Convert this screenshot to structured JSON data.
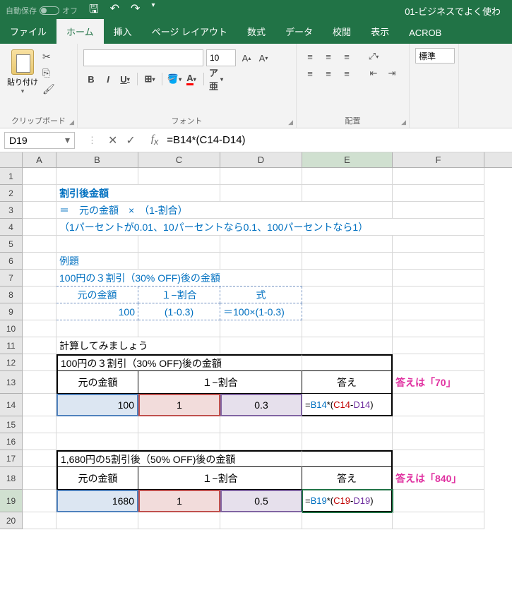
{
  "title_bar": {
    "autosave_label": "自動保存",
    "autosave_state": "オフ",
    "doc_title": "01-ビジネスでよく使わ"
  },
  "tabs": {
    "file": "ファイル",
    "home": "ホーム",
    "insert": "挿入",
    "page_layout": "ページ レイアウト",
    "formulas": "数式",
    "data": "データ",
    "review": "校閲",
    "view": "表示",
    "acrobat": "ACROB"
  },
  "ribbon": {
    "clipboard": {
      "paste": "貼り付け",
      "label": "クリップボード"
    },
    "font": {
      "size": "10",
      "label": "フォント"
    },
    "alignment": {
      "label": "配置"
    },
    "number": {
      "format": "標準"
    }
  },
  "formula_bar": {
    "namebox": "D19",
    "formula": "=B14*(C14-D14)"
  },
  "columns": [
    "A",
    "B",
    "C",
    "D",
    "E",
    "F"
  ],
  "cells": {
    "r2": {
      "b": "割引後金額"
    },
    "r3": {
      "b": "＝　元の金額　×　（1-割合）"
    },
    "r4": {
      "b": "（1パーセントが0.01、10パーセントなら0.1、100パーセントなら1）"
    },
    "r6": {
      "b": "例題"
    },
    "r7": {
      "b": "100円の３割引（30% OFF)後の金額"
    },
    "r8": {
      "b": "元の金額",
      "c": "１−割合",
      "d": "式"
    },
    "r9": {
      "b": "100",
      "c": "(1-0.3)",
      "d": "＝100×(1-0.3)"
    },
    "r11": {
      "b": "計算してみましょう"
    },
    "r12": {
      "b": "100円の３割引（30% OFF)後の金額"
    },
    "r13": {
      "b": "元の金額",
      "cd": "１−割合",
      "e": "答え",
      "f": "答えは「70」"
    },
    "r14": {
      "b": "100",
      "c": "1",
      "d": "0.3",
      "e_pre": "=",
      "e_b": "B14",
      "e_mid": "*(",
      "e_c": "C14",
      "e_dash": "-",
      "e_d": "D14",
      "e_post": ")"
    },
    "r17": {
      "b": "1,680円の5割引後（50% OFF)後の金額"
    },
    "r18": {
      "b": "元の金額",
      "cd": "１−割合",
      "e": "答え",
      "f": "答えは「840」"
    },
    "r19": {
      "b": "1680",
      "c": "1",
      "d": "0.5",
      "e_pre": "=",
      "e_b": "B19",
      "e_mid": "*(",
      "e_c": "C19",
      "e_dash": "-",
      "e_d": "D19",
      "e_post": ")"
    }
  }
}
